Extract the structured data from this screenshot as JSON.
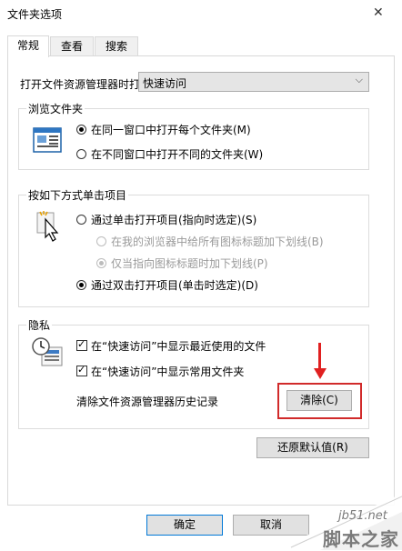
{
  "window": {
    "title": "文件夹选项",
    "close_glyph": "✕"
  },
  "tabs": [
    {
      "label": "常规",
      "active": true
    },
    {
      "label": "查看",
      "active": false
    },
    {
      "label": "搜索",
      "active": false
    }
  ],
  "open_explorer": {
    "label": "打开文件资源管理器时打",
    "value": "快速访问",
    "chevron": "⌵"
  },
  "browse": {
    "title": "浏览文件夹",
    "options": [
      {
        "label": "在同一窗口中打开每个文件夹(M)",
        "selected": true
      },
      {
        "label": "在不同窗口中打开不同的文件夹(W)",
        "selected": false
      }
    ]
  },
  "click": {
    "title": "按如下方式单击项目",
    "single": {
      "label": "通过单击打开项目(指向时选定)(S)",
      "selected": false
    },
    "sub": [
      {
        "label": "在我的浏览器中给所有图标标题加下划线(B)",
        "selected": false,
        "disabled": true
      },
      {
        "label": "仅当指向图标标题时加下划线(P)",
        "selected": true,
        "disabled": true
      }
    ],
    "double": {
      "label": "通过双击打开项目(单击时选定)(D)",
      "selected": true
    }
  },
  "privacy": {
    "title": "隐私",
    "checks": [
      {
        "label": "在“快速访问”中显示最近使用的文件",
        "checked": true
      },
      {
        "label": "在“快速访问”中显示常用文件夹",
        "checked": true
      }
    ],
    "clear_label": "清除文件资源管理器历史记录",
    "clear_button": "清除(C)"
  },
  "restore_button": "还原默认值(R)",
  "footer": {
    "ok": "确定",
    "cancel": "取消"
  },
  "watermark": {
    "url": "jb51.net",
    "name": "脚本之家"
  },
  "annotation_color": "#e02020"
}
